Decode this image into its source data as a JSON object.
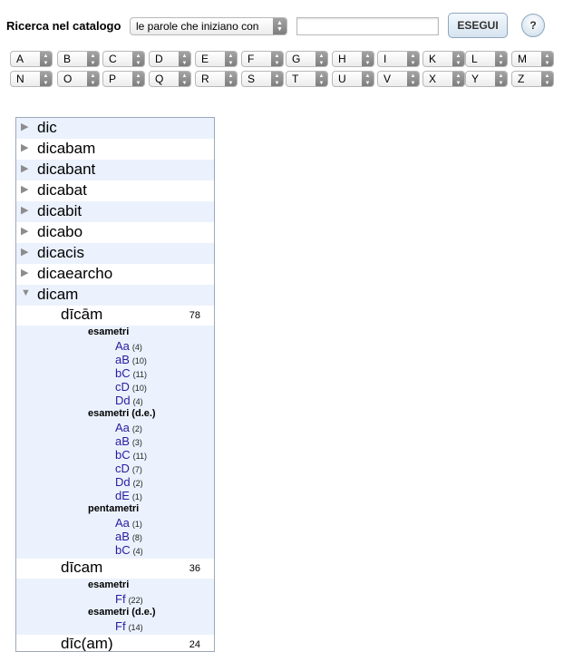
{
  "search": {
    "label": "Ricerca nel catalogo",
    "mode": "le parole che iniziano con",
    "query": "",
    "execute_label": "ESEGUI",
    "help_label": "?"
  },
  "letters": {
    "row1": [
      "A",
      "B",
      "C",
      "D",
      "E",
      "F",
      "G",
      "H",
      "I",
      "K",
      "L",
      "M"
    ],
    "row2": [
      "N",
      "O",
      "P",
      "Q",
      "R",
      "S",
      "T",
      "U",
      "V",
      "X",
      "Y",
      "Z"
    ]
  },
  "tree": {
    "entries": [
      {
        "word": "dic"
      },
      {
        "word": "dicabam"
      },
      {
        "word": "dicabant"
      },
      {
        "word": "dicabat"
      },
      {
        "word": "dicabit"
      },
      {
        "word": "dicabo"
      },
      {
        "word": "dicacis"
      },
      {
        "word": "dicaearcho"
      },
      {
        "word": "dicam"
      }
    ],
    "forms": [
      {
        "word": "dīcām",
        "count": "78",
        "groups": [
          {
            "meter": "esametri",
            "schemes": [
              {
                "name": "Aa",
                "count": "(4)"
              },
              {
                "name": "aB",
                "count": "(10)"
              },
              {
                "name": "bC",
                "count": "(11)"
              },
              {
                "name": "cD",
                "count": "(10)"
              },
              {
                "name": "Dd",
                "count": "(4)"
              }
            ]
          },
          {
            "meter": "esametri (d.e.)",
            "schemes": [
              {
                "name": "Aa",
                "count": "(2)"
              },
              {
                "name": "aB",
                "count": "(3)"
              },
              {
                "name": "bC",
                "count": "(11)"
              },
              {
                "name": "cD",
                "count": "(7)"
              },
              {
                "name": "Dd",
                "count": "(2)"
              },
              {
                "name": "dE",
                "count": "(1)"
              }
            ]
          },
          {
            "meter": "pentametri",
            "schemes": [
              {
                "name": "Aa",
                "count": "(1)"
              },
              {
                "name": "aB",
                "count": "(8)"
              },
              {
                "name": "bC",
                "count": "(4)"
              }
            ]
          }
        ]
      },
      {
        "word": "dīcam",
        "count": "36",
        "groups": [
          {
            "meter": "esametri",
            "schemes": [
              {
                "name": "Ff",
                "count": "(22)"
              }
            ]
          },
          {
            "meter": "esametri (d.e.)",
            "schemes": [
              {
                "name": "Ff",
                "count": "(14)"
              }
            ]
          }
        ]
      },
      {
        "word": "dīc(am)",
        "count": "24",
        "groups": []
      }
    ]
  }
}
